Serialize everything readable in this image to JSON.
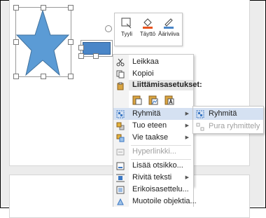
{
  "mini_toolbar": {
    "style_label": "Tyyli",
    "fill_label": "Täyttö",
    "outline_label": "Ääriviiva",
    "colors": {
      "accent": "#4a86c8",
      "fill_accent": "#e8531d"
    }
  },
  "context_menu": {
    "cut_label": "Leikkaa",
    "copy_label": "Kopioi",
    "paste_options_label": "Liittämisasetukset:",
    "group_label": "Ryhmitä",
    "bring_forward_label": "Tuo eteen",
    "send_backward_label": "Vie taakse",
    "hyperlink_label": "Hyperlinkki...",
    "insert_caption_label": "Lisää otsikko...",
    "wrap_text_label": "Rivitä teksti",
    "advanced_layout_label": "Erikoisasettelu...",
    "format_object_label": "Muotoile objektia..."
  },
  "submenu": {
    "group_label": "Ryhmitä",
    "ungroup_label": "Pura ryhmittely"
  },
  "shapes": {
    "star_color": "#5b9bd5",
    "rect_color": "#4a86c8"
  }
}
